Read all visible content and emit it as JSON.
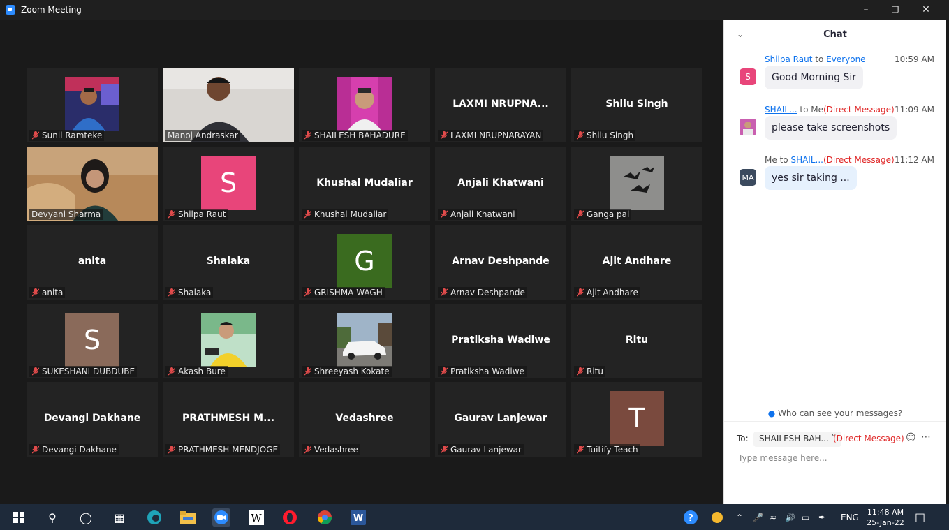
{
  "window": {
    "title": "Zoom Meeting"
  },
  "participants": [
    {
      "name": "Sunil Ramteke",
      "label": "Sunil Ramteke",
      "muted": true,
      "kind": "photo",
      "photo": "man-blue-shirt"
    },
    {
      "name": "Manoj Andraskar",
      "label": "Manoj Andraskar",
      "muted": false,
      "kind": "video"
    },
    {
      "name": "SHAILESH BAHADURE",
      "label": "SHAILESH BAHADURE",
      "muted": true,
      "kind": "photo",
      "photo": "man-pink-bg"
    },
    {
      "name": "LAXMI NRUPNA...",
      "label": "LAXMI NRUPNARAYAN",
      "muted": true,
      "kind": "name"
    },
    {
      "name": "Shilu Singh",
      "label": "Shilu Singh",
      "muted": true,
      "kind": "name"
    },
    {
      "name": "Devyani Sharma",
      "label": "Devyani Sharma",
      "muted": false,
      "kind": "video",
      "active": true
    },
    {
      "name": "Shilpa Raut",
      "label": "Shilpa Raut",
      "muted": true,
      "kind": "avatar",
      "letter": "S",
      "color": "#e8457a"
    },
    {
      "name": "Khushal Mudaliar",
      "label": "Khushal Mudaliar",
      "muted": true,
      "kind": "name"
    },
    {
      "name": "Anjali Khatwani",
      "label": "Anjali Khatwani",
      "muted": true,
      "kind": "name"
    },
    {
      "name": "Ganga pal",
      "label": "Ganga pal",
      "muted": true,
      "kind": "photo",
      "photo": "bats-art"
    },
    {
      "name": "anita",
      "label": "anita",
      "muted": true,
      "kind": "name"
    },
    {
      "name": "Shalaka",
      "label": "Shalaka",
      "muted": true,
      "kind": "name"
    },
    {
      "name": "GRISHMA WAGH",
      "label": "GRISHMA WAGH",
      "muted": true,
      "kind": "avatar",
      "letter": "G",
      "color": "#3a6b1f"
    },
    {
      "name": "Arnav Deshpande",
      "label": "Arnav Deshpande",
      "muted": true,
      "kind": "name"
    },
    {
      "name": "Ajit Andhare",
      "label": "Ajit Andhare",
      "muted": true,
      "kind": "name"
    },
    {
      "name": "SUKESHANI DUBDUBE",
      "label": "SUKESHANI DUBDUBE",
      "muted": true,
      "kind": "avatar",
      "letter": "S",
      "color": "#8a6a5a"
    },
    {
      "name": "Akash Bure",
      "label": "Akash Bure",
      "muted": true,
      "kind": "photo",
      "photo": "man-yellow-shirt"
    },
    {
      "name": "Shreeyash Kokate",
      "label": "Shreeyash Kokate",
      "muted": true,
      "kind": "photo",
      "photo": "white-car"
    },
    {
      "name": "Pratiksha Wadiwe",
      "label": "Pratiksha Wadiwe",
      "muted": true,
      "kind": "name"
    },
    {
      "name": "Ritu",
      "label": "Ritu",
      "muted": true,
      "kind": "name"
    },
    {
      "name": "Devangi Dakhane",
      "label": "Devangi Dakhane",
      "muted": true,
      "kind": "name"
    },
    {
      "name": "PRATHMESH M...",
      "label": "PRATHMESH MENDJOGE",
      "muted": true,
      "kind": "name"
    },
    {
      "name": "Vedashree",
      "label": "Vedashree",
      "muted": true,
      "kind": "name"
    },
    {
      "name": "Gaurav Lanjewar",
      "label": "Gaurav Lanjewar",
      "muted": true,
      "kind": "name"
    },
    {
      "name": "Tuitify Teach",
      "label": "Tuitify Teach",
      "muted": true,
      "kind": "avatar",
      "letter": "T",
      "color": "#7a4a3e"
    }
  ],
  "chat": {
    "title": "Chat",
    "messages": [
      {
        "sender": "Shilpa Raut",
        "to_word": "to",
        "recipient": "Everyone",
        "direct": "",
        "time": "10:59 AM",
        "text": "Good Morning Sir",
        "avatar_letter": "S",
        "avatar_color": "#e8457a"
      },
      {
        "sender": "SHAIL...",
        "to_word": "to",
        "recipient": "Me",
        "direct": "(Direct Message)",
        "time": "11:09 AM",
        "text": "please take screenshots",
        "avatar_letter": "",
        "avatar_color": "#c95fb0"
      },
      {
        "sender": "Me",
        "to_word": "to",
        "recipient": "SHAIL...",
        "direct": "(Direct Message)",
        "time": "11:12 AM",
        "text": "yes sir taking ...",
        "avatar_letter": "MA",
        "avatar_color": "#3b4a5e"
      }
    ],
    "who_can_see": "Who can see your messages?",
    "to_label": "To:",
    "to_recipient": "SHAILESH BAH...",
    "to_direct": "(Direct Message)",
    "input_placeholder": "Type message here..."
  },
  "taskbar": {
    "language": "ENG",
    "time": "11:48 AM",
    "date": "25-Jan-22"
  }
}
